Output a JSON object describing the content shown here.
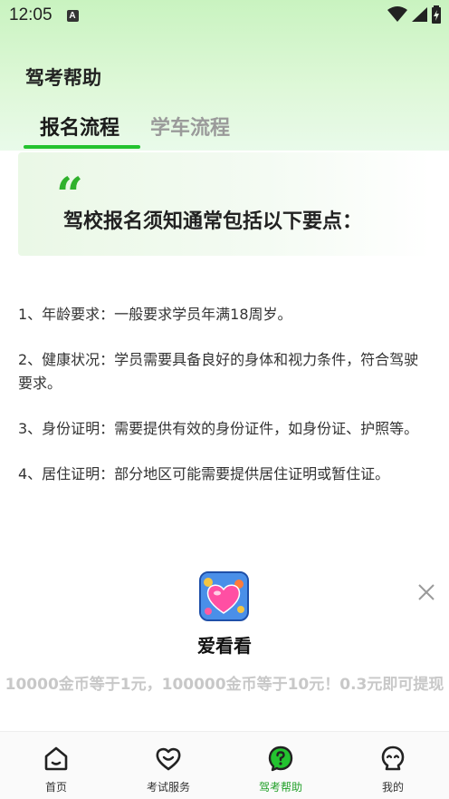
{
  "status_bar": {
    "time": "12:05",
    "notification_badge": "A",
    "icons": [
      "wifi-icon",
      "signal-icon",
      "battery-icon"
    ]
  },
  "header": {
    "title": "驾考帮助"
  },
  "tabs": [
    {
      "label": "报名流程",
      "active": true
    },
    {
      "label": "学车流程",
      "active": false
    }
  ],
  "card": {
    "quote_glyph": "“",
    "heading": "驾校报名须知通常包括以下要点："
  },
  "content": {
    "items": [
      "1、年龄要求：一般要求学员年满18周岁。",
      "2、健康状况：学员需要具备良好的身体和视力条件，符合驾驶要求。",
      "3、身份证明：需要提供有效的身份证件，如身份证、护照等。",
      "4、居住证明：部分地区可能需要提供居住证明或暂住证。"
    ]
  },
  "ad": {
    "app_name": "爱看看",
    "description": "10000金币等于1元，100000金币等于10元！0.3元即可提现",
    "icon": "heart-app-icon"
  },
  "bottom_nav": [
    {
      "label": "首页",
      "icon": "home-icon",
      "active": false
    },
    {
      "label": "考试服务",
      "icon": "heart-face-icon",
      "active": false
    },
    {
      "label": "驾考帮助",
      "icon": "help-icon",
      "active": true
    },
    {
      "label": "我的",
      "icon": "profile-icon",
      "active": false
    }
  ],
  "colors": {
    "accent": "#23c32f",
    "header_bg": "#c9f3c0"
  }
}
